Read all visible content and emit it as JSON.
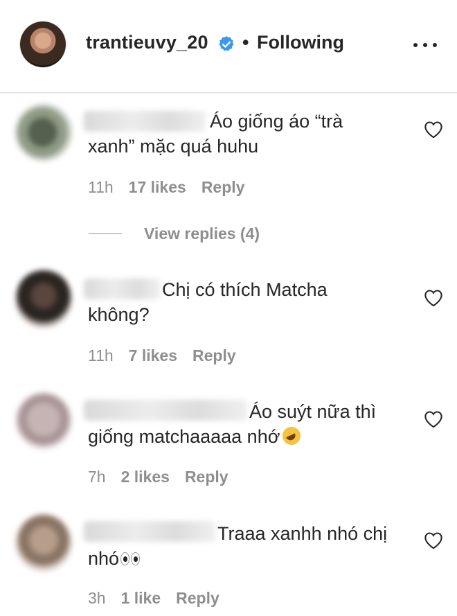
{
  "header": {
    "username": "trantieuvy_20",
    "separator": "•",
    "follow_status": "Following",
    "verified_icon": "verified-badge-icon",
    "more_icon": "more-options-icon",
    "verified_color": "#3897f0"
  },
  "comments": [
    {
      "text": "Áo giống áo “trà xanh” mặc quá huhu",
      "time": "11h",
      "likes": "17 likes",
      "reply": "Reply",
      "view_replies": "View replies (4)"
    },
    {
      "text": "Chị có thích Matcha không?",
      "time": "11h",
      "likes": "7 likes",
      "reply": "Reply"
    },
    {
      "text": "Áo suýt nữa thì giống matchaaaaa nhớ",
      "emoji": "rolling-on-floor-laughing-emoji",
      "time": "7h",
      "likes": "2 likes",
      "reply": "Reply"
    },
    {
      "text": "Traaa xanhh nhó chị nhó",
      "emoji": "eyes-emoji",
      "time": "3h",
      "likes": "1 like",
      "reply": "Reply"
    }
  ],
  "colors": {
    "text": "#262626",
    "meta": "#8e8e8e",
    "divider": "#e6e6e6"
  }
}
